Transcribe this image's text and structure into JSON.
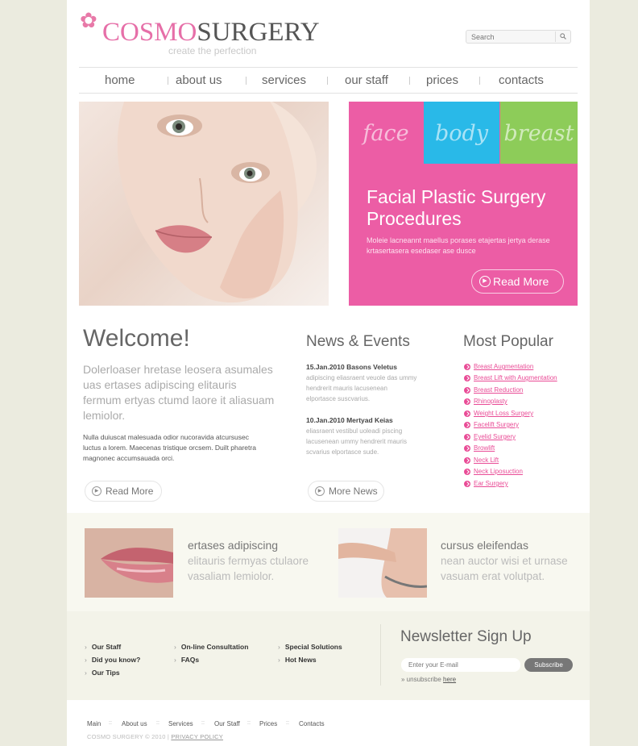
{
  "brand": {
    "name_part1": "COSMO",
    "name_part2": "SURGERY",
    "tagline": "create the perfection",
    "accent_color": "#ec5da5"
  },
  "search": {
    "placeholder": "Search",
    "icon": "magnifier-icon"
  },
  "nav": [
    "home",
    "about us",
    "services",
    "our staff",
    "prices",
    "contacts"
  ],
  "hero": {
    "categories": [
      "face",
      "body",
      "breast"
    ],
    "category_colors": [
      "#ec5da5",
      "#29b9e8",
      "#8dcc59"
    ],
    "title": "Facial Plastic Surgery Procedures",
    "description": "Moleie lacneannt maellus porases etajertas jertya derase krtasertasera esedaser ase dusce",
    "button": "Read More"
  },
  "welcome": {
    "title": "Welcome!",
    "lead": "Dolerloaser hretase leosera asumales uas ertases adipiscing elitauris fermum ertyas ctumd laore it aliasuam lemiolor.",
    "body": "Nulla duiuscat malesuada odior nucoravida atcursusec luctus a lorem. Maecenas tristique orcsem. Duilt pharetra magnonec accumsauada orci.",
    "button": "Read More"
  },
  "news": {
    "title": "News & Events",
    "items": [
      {
        "date": "15.Jan.2010 Basons Veletus",
        "text": "adipiscing eliasraent veuole das ummy hendrerit mauris lacusenean elportasce suscvarius."
      },
      {
        "date": "10.Jan.2010 Mertyad Keias",
        "text": "eliasraent vestibul uoleadi piscing lacusenean ummy hendrerit mauris scvarius elportasce sude."
      }
    ],
    "button": "More News"
  },
  "popular": {
    "title": "Most Popular",
    "items": [
      "Breast Augmentation",
      "Breast Lift with Augmentation",
      "Breast Reduction",
      "Rhinoplasty",
      "Weight Loss Surgery",
      "Facelift Surgery",
      "Eyelid Surgery",
      "Browlift",
      "Neck Lift",
      "Neck Liposuction",
      "Ear Surgery"
    ]
  },
  "features": [
    {
      "heading": "ertases adipiscing",
      "text": "elitauris fermyas ctulaore vasaliam lemiolor."
    },
    {
      "heading": "cursus eleifendas",
      "text": "nean auctor wisi et urnase vasuam erat volutpat."
    }
  ],
  "footer_links": {
    "col1": [
      "Our Staff",
      "Did you know?",
      "Our Tips"
    ],
    "col2": [
      "On-line Consultation",
      "FAQs"
    ],
    "col3": [
      "Special Solutions",
      "Hot News"
    ]
  },
  "newsletter": {
    "title": "Newsletter Sign Up",
    "placeholder": "Enter your E-mail",
    "button": "Subscribe",
    "unsubscribe_prefix": "» unsubscribe",
    "unsubscribe_link": "here"
  },
  "bottom_nav": [
    "Main",
    "About us",
    "Services",
    "Our Staff",
    "Prices",
    "Contacts"
  ],
  "copyright": {
    "text": "COSMO SURGERY © 2010 |",
    "policy": "PRIVACY POLICY"
  }
}
